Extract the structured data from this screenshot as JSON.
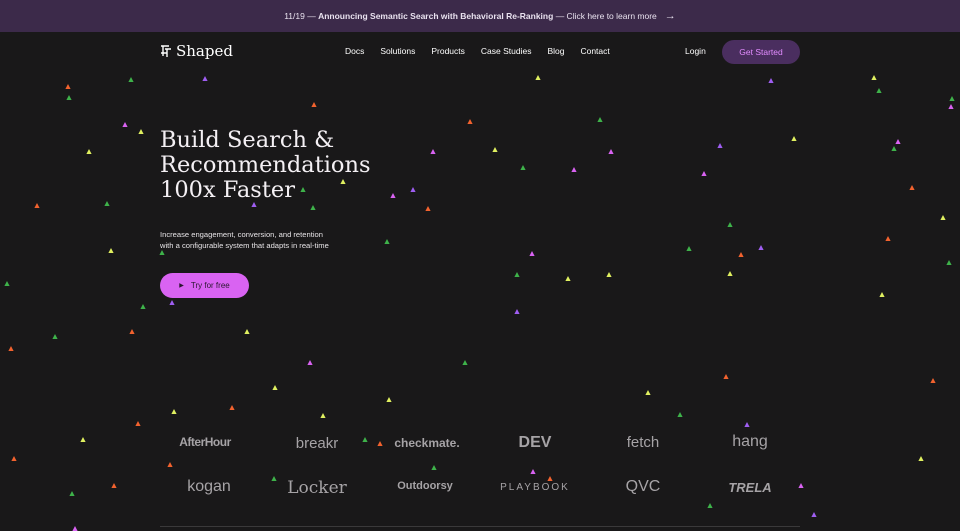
{
  "announcement": {
    "date": "11/19 —",
    "bold": "Announcing Semantic Search with Behavioral Re-Ranking",
    "tail": "— Click here to learn more"
  },
  "nav": {
    "brand": "Shaped",
    "links": [
      "Docs",
      "Solutions",
      "Products",
      "Case Studies",
      "Blog",
      "Contact"
    ],
    "login": "Login",
    "get_started": "Get Started"
  },
  "hero": {
    "title_lines": [
      "Build Search &",
      "Recommendations",
      "100x Faster"
    ],
    "subtitle_lines": [
      "Increase engagement, conversion, and retention",
      "with a configurable system that adapts in real-time"
    ],
    "try_label": "Try for free"
  },
  "customer_logos": [
    "AfterHour",
    "breakr",
    "checkmate.",
    "DEV",
    "fetch",
    "hang",
    "kogan",
    "Locker",
    "Outdoorsy",
    "PLAYBOOK",
    "QVC",
    "TRELA"
  ],
  "colors": {
    "background": "#191819",
    "announcement_bg": "#3c2a4a",
    "accent": "#d963f2",
    "cta_bg": "#4a2e5f",
    "particles": [
      "#e0f060",
      "#3eb24a",
      "#f2622e",
      "#9f5ef2",
      "#d963f2"
    ]
  }
}
